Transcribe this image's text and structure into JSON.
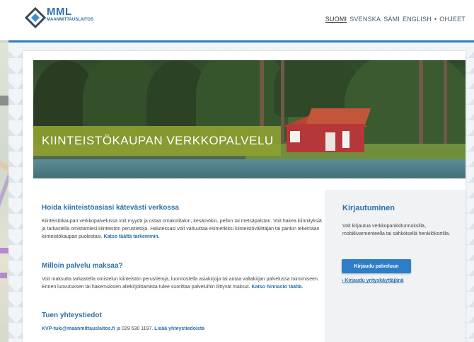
{
  "logo": {
    "name": "MML",
    "subtitle": "MAANMITTAUSLAITOS"
  },
  "languages": [
    {
      "label": "SUOMI",
      "active": true
    },
    {
      "label": "SVENSKA",
      "active": false
    },
    {
      "label": "SÁMI",
      "active": false
    },
    {
      "label": "ENGLISH",
      "active": false
    }
  ],
  "lang_separator": "•",
  "help_link": "OHJEET",
  "hero": {
    "banner_text": "KIINTEISTÖKAUPAN VERKKOPALVELU"
  },
  "main": {
    "section1": {
      "title": "Hoida kiinteistöasiasi kätevästi verkossa",
      "body": "Kiinteistökaupan verkkopalvelussa voit myydä ja ostaa omakotitalon, kesämökin, pellon tai metsäpalstan. Voit hakea kiinnityksiä ja tarkastella omistamiesi kiinteistön perustietoja. Halutessasi voit valtuuttaa esimerkiksi kiinteistövälittäjän tai pankin tekemään kiinteistökaupan puolestasi.",
      "link": "Katso täältä tarkemmin."
    },
    "section2": {
      "title": "Milloin palvelu maksaa?",
      "body": "Voit maksutta tarkastella omistelun kiinteistön perustietoja, luonnostella asiakirjoja tai antaa valtakirjan palvelussa toimimiseen. Ennen luovutuksen tai hakemuksien allekirjoittamista tulee suorittaa palveluihin liittyvät maksut.",
      "link": "Katso hinnasto täältä."
    },
    "section3": {
      "title": "Tuen yhteystiedot",
      "email": "KVP-tuki@maanmittauslaitos.fi",
      "phone_text": "ja 029 530 1197.",
      "link": "Lisää yhteystiedoista"
    }
  },
  "sidebar": {
    "title": "Kirjautuminen",
    "body": "Voit kirjautua verkkopankkitunnuksilla, mobiilivarmenteella tai sähköisellä henkilökortilla.",
    "login_button": "Kirjaudu palveluun",
    "company_link": "› Kirjaudu yrityskäyttäjänä"
  },
  "colors": {
    "brand_blue": "#2d6fa8",
    "button_blue": "#2d7dc8",
    "banner_green": "#8ca032",
    "top_line": "#2d7dbf"
  }
}
